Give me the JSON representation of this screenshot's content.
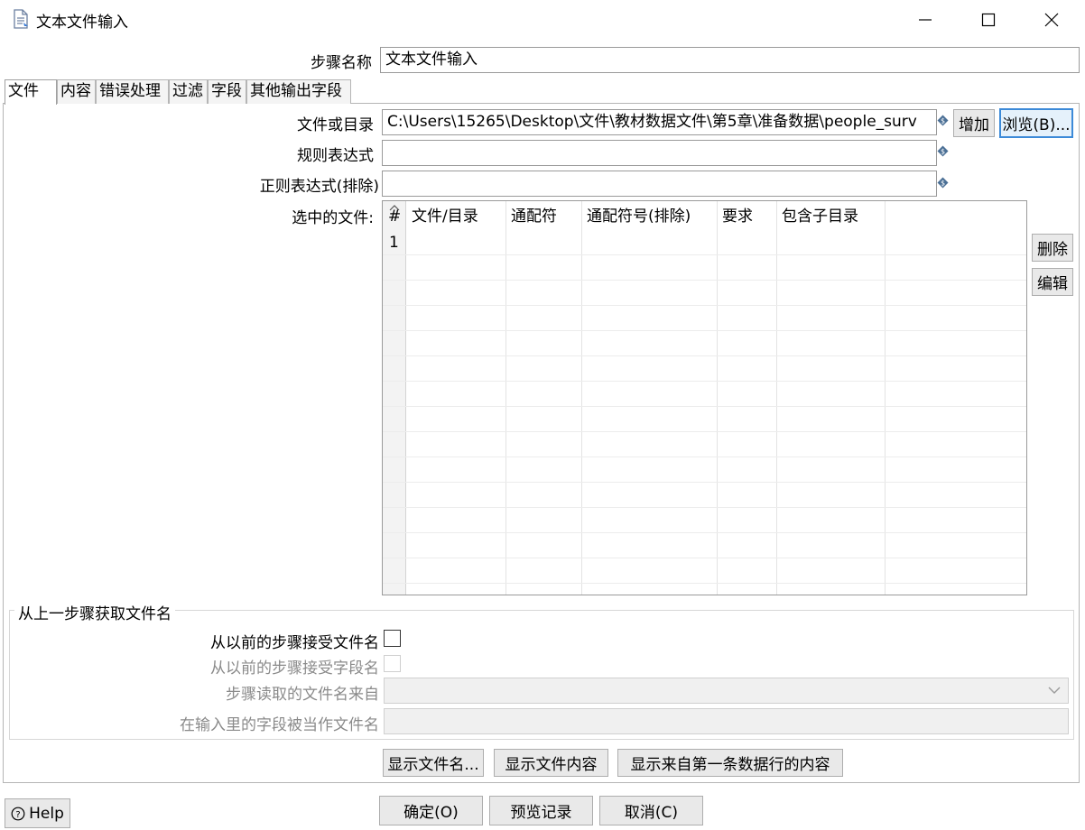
{
  "window": {
    "title": "文本文件输入",
    "controls": {
      "minimize": "minimize",
      "maximize": "maximize",
      "close": "close"
    }
  },
  "step_name": {
    "label": "步骤名称",
    "value": "文本文件输入"
  },
  "tabs": [
    {
      "label": "文件",
      "active": true
    },
    {
      "label": "内容"
    },
    {
      "label": "错误处理"
    },
    {
      "label": "过滤"
    },
    {
      "label": "字段"
    },
    {
      "label": "其他输出字段"
    }
  ],
  "file_tab": {
    "file_or_dir": {
      "label": "文件或目录",
      "value": "C:\\Users\\15265\\Desktop\\文件\\教材数据文件\\第5章\\准备数据\\people_surv"
    },
    "regex": {
      "label": "规则表达式",
      "value": ""
    },
    "regex_exclude": {
      "label": "正则表达式(排除)",
      "value": ""
    },
    "add_button": "增加",
    "browse_button": "浏览(B)...",
    "selected_files": {
      "label": "选中的文件:",
      "columns": [
        "#",
        "文件/目录",
        "通配符",
        "通配符号(排除)",
        "要求",
        "包含子目录"
      ],
      "rows": [
        [
          "1",
          "",
          "",
          "",
          "",
          ""
        ]
      ],
      "delete_button": "删除",
      "edit_button": "编辑"
    },
    "from_previous": {
      "group_title": "从上一步骤获取文件名",
      "accept_filenames": {
        "label": "从以前的步骤接受文件名",
        "checked": false
      },
      "accept_fieldname": {
        "label": "从以前的步骤接受字段名",
        "checked": false
      },
      "step_to_read_from": {
        "label": "步骤读取的文件名来自",
        "value": ""
      },
      "field_as_filename": {
        "label": "在输入里的字段被当作文件名",
        "value": ""
      }
    },
    "show_filenames_button": "显示文件名...",
    "show_file_content_button": "显示文件内容",
    "show_first_row_button": "显示来自第一条数据行的内容"
  },
  "footer": {
    "help_button": "Help",
    "ok_button": "确定(O)",
    "preview_button": "预览记录",
    "cancel_button": "取消(C)"
  },
  "colors": {
    "focus_border": "#3c8ad8",
    "variable_icon": "#4a6f95"
  }
}
